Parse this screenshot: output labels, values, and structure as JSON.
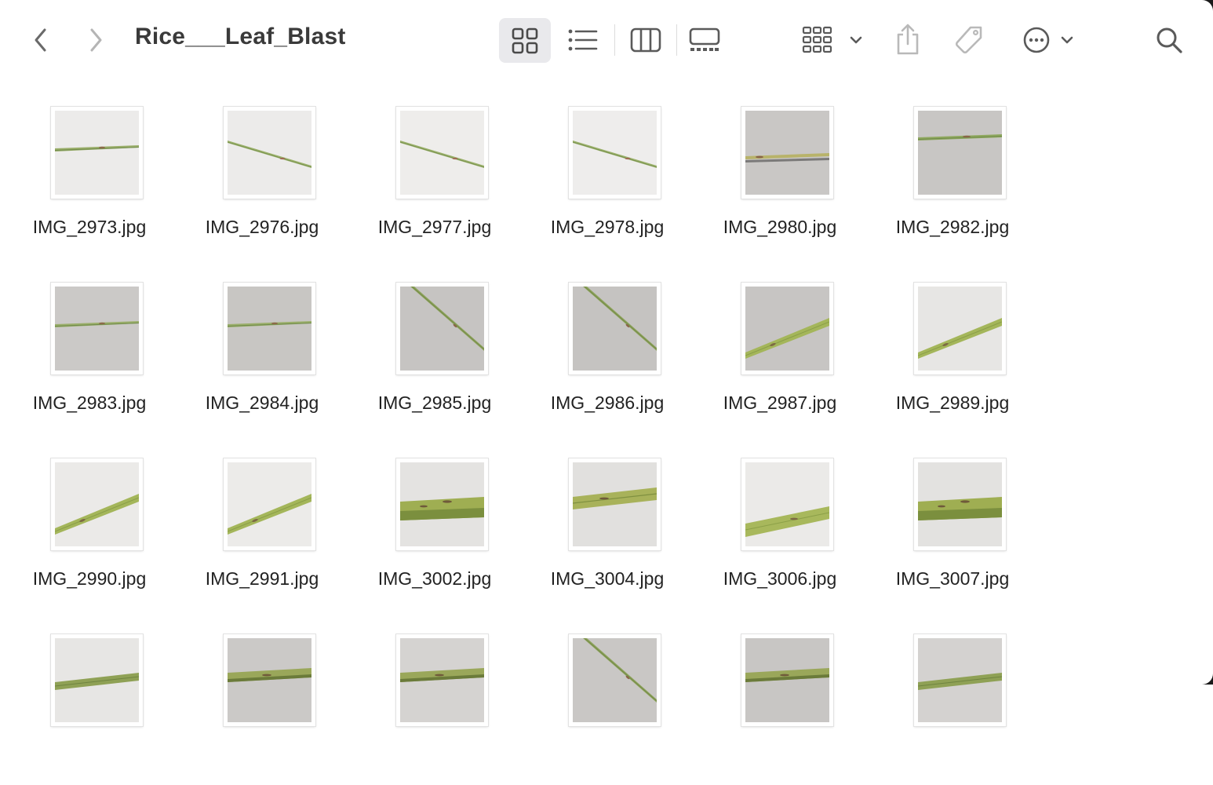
{
  "window": {
    "folder_title": "Rice___Leaf_Blast"
  },
  "toolbar": {
    "icons": [
      "chevron-left-icon",
      "chevron-right-icon",
      "grid-view-icon",
      "list-view-icon",
      "column-view-icon",
      "gallery-view-icon",
      "group-by-icon",
      "share-icon",
      "tag-icon",
      "more-options-icon",
      "search-icon"
    ],
    "selected_view": "icon",
    "back_enabled": true,
    "forward_enabled": false
  },
  "files": [
    {
      "name": "IMG_2973.jpg",
      "bg": "#ecebea",
      "leaf": "thin-horizontal"
    },
    {
      "name": "IMG_2976.jpg",
      "bg": "#ecebea",
      "leaf": "thin-diag-down"
    },
    {
      "name": "IMG_2977.jpg",
      "bg": "#eeedeb",
      "leaf": "thin-diag-down"
    },
    {
      "name": "IMG_2978.jpg",
      "bg": "#eeedec",
      "leaf": "thin-diag-down"
    },
    {
      "name": "IMG_2980.jpg",
      "bg": "#c9c7c5",
      "leaf": "shadow-horizontal"
    },
    {
      "name": "IMG_2982.jpg",
      "bg": "#c8c6c4",
      "leaf": "thin-horizontal-top"
    },
    {
      "name": "IMG_2983.jpg",
      "bg": "#cbc9c7",
      "leaf": "thin-horizontal"
    },
    {
      "name": "IMG_2984.jpg",
      "bg": "#c8c6c3",
      "leaf": "thin-horizontal"
    },
    {
      "name": "IMG_2985.jpg",
      "bg": "#c6c4c2",
      "leaf": "steep-diag"
    },
    {
      "name": "IMG_2986.jpg",
      "bg": "#c5c3c1",
      "leaf": "steep-diag"
    },
    {
      "name": "IMG_2987.jpg",
      "bg": "#c7c5c3",
      "leaf": "wide-diag-up"
    },
    {
      "name": "IMG_2989.jpg",
      "bg": "#e7e6e4",
      "leaf": "wide-diag-up"
    },
    {
      "name": "IMG_2990.jpg",
      "bg": "#ebeae8",
      "leaf": "wide-diag-up"
    },
    {
      "name": "IMG_2991.jpg",
      "bg": "#ecebe9",
      "leaf": "wide-diag-up"
    },
    {
      "name": "IMG_3002.jpg",
      "bg": "#e4e3e1",
      "leaf": "wide-horizontal"
    },
    {
      "name": "IMG_3004.jpg",
      "bg": "#e1e0de",
      "leaf": "wide-slight-up"
    },
    {
      "name": "IMG_3006.jpg",
      "bg": "#ebeae8",
      "leaf": "wide-slight-up-low"
    },
    {
      "name": "IMG_3007.jpg",
      "bg": "#e3e2e0",
      "leaf": "wide-horizontal"
    },
    {
      "name": "",
      "bg": "#e7e6e4",
      "leaf": "thin-horizontal-bottom"
    },
    {
      "name": "",
      "bg": "#cbc9c7",
      "leaf": "wide-horizontal-bottom"
    },
    {
      "name": "",
      "bg": "#d5d3d1",
      "leaf": "wide-horizontal-bottom"
    },
    {
      "name": "",
      "bg": "#c9c7c5",
      "leaf": "steep-diag"
    },
    {
      "name": "",
      "bg": "#c8c6c4",
      "leaf": "wide-horizontal-bottom"
    },
    {
      "name": "",
      "bg": "#d4d2d0",
      "leaf": "thin-horizontal-bottom"
    }
  ]
}
